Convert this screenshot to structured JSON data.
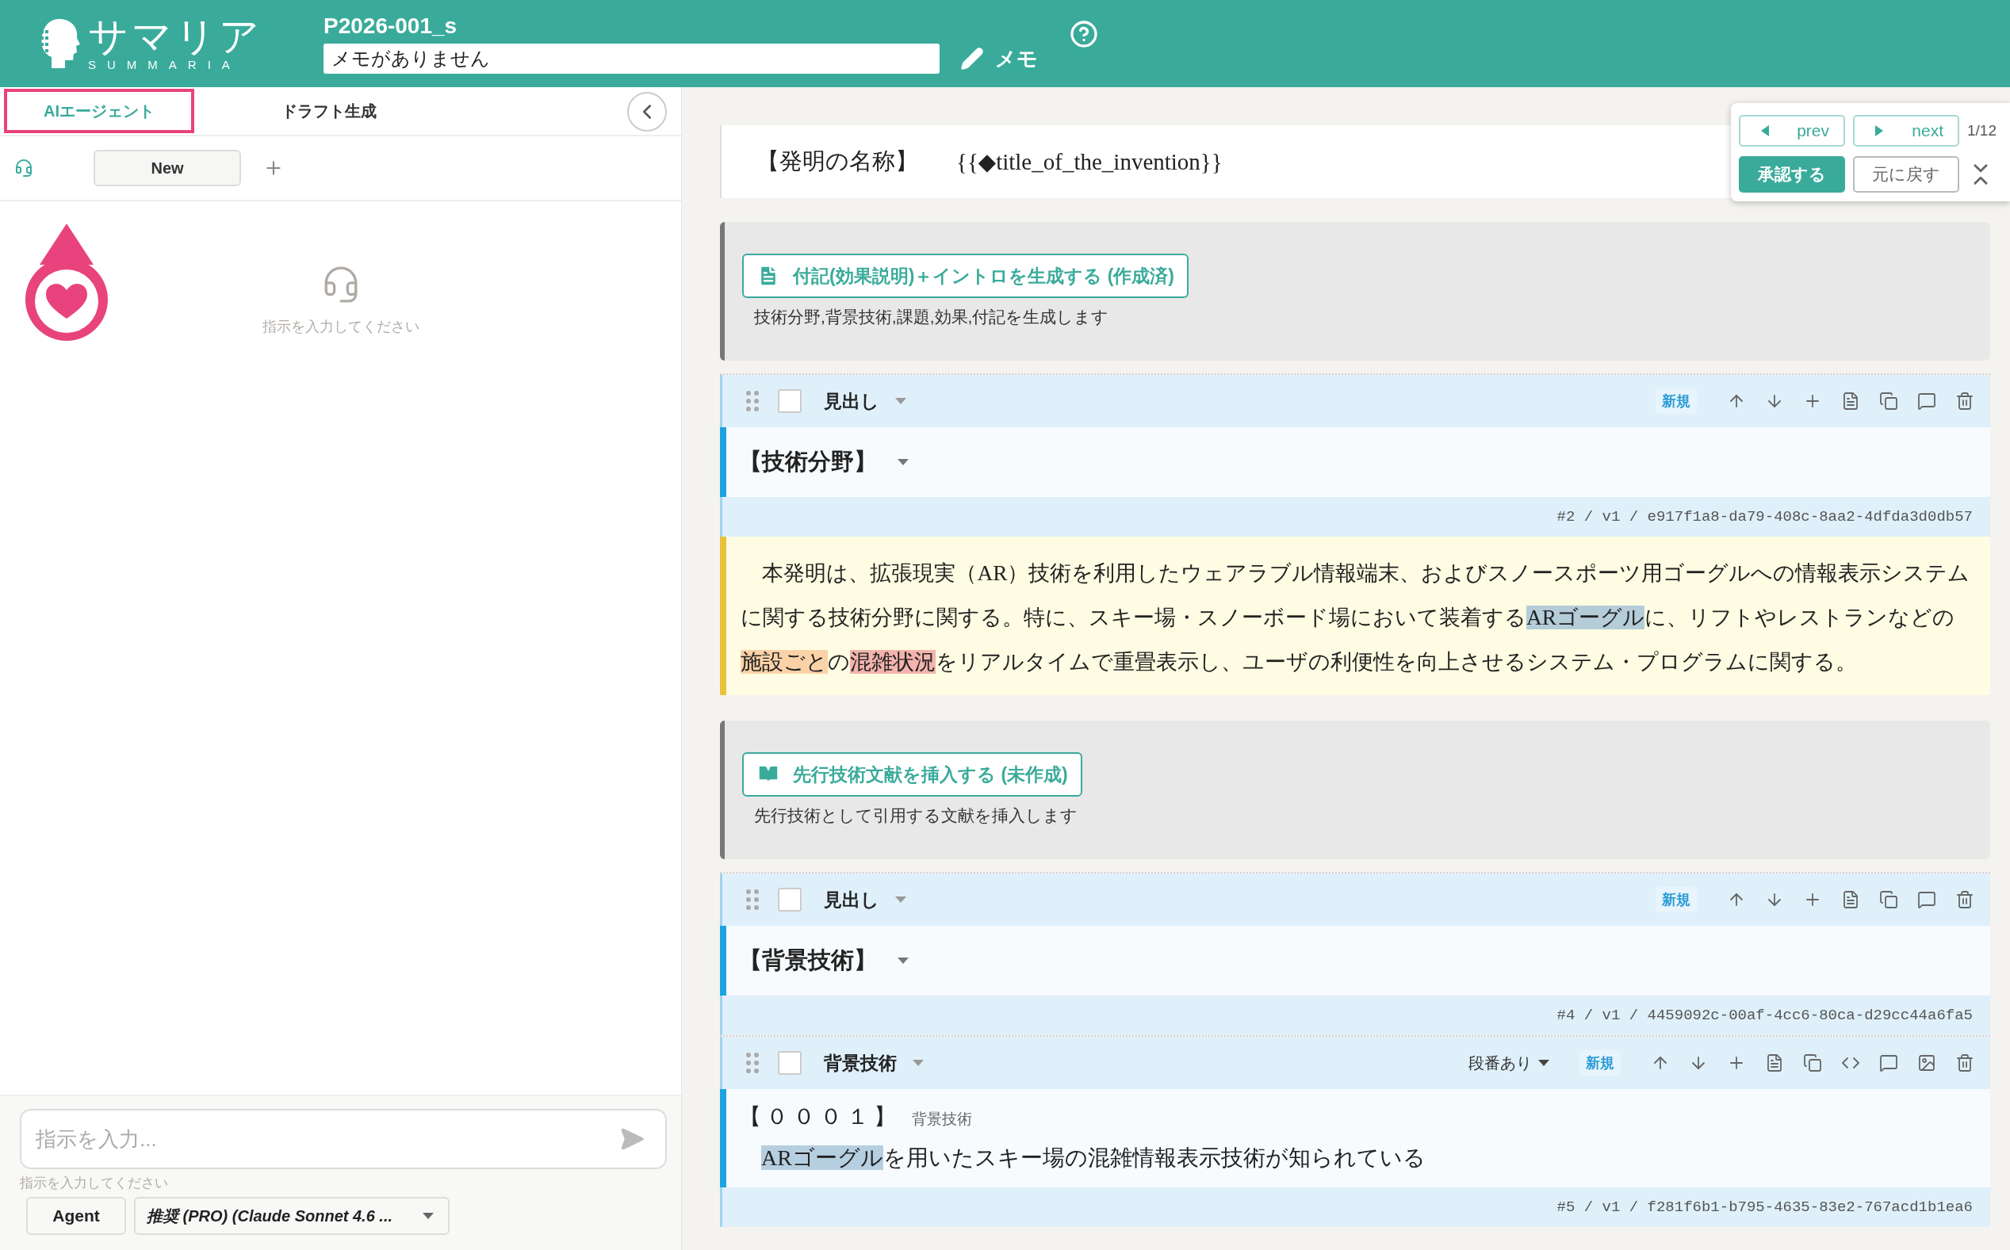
{
  "header": {
    "logo": {
      "kana": "サマリア",
      "latin": "SUMMARIA"
    },
    "project_title": "P2026-001_s",
    "memo": {
      "value": "メモがありません"
    },
    "memo_button": "メモ"
  },
  "left_panel": {
    "tabs": [
      {
        "label": "AIエージェント",
        "selected": true
      },
      {
        "label": "ドラフト生成",
        "selected": false
      }
    ],
    "sessions": [
      {
        "label": "New",
        "selected": true
      }
    ],
    "empty_state": "指示を入力してください",
    "input": {
      "placeholder": "指示を入力..."
    },
    "hint": "指示を入力してください",
    "mode_button": "Agent",
    "model_select": "推奨 (PRO) (Claude Sonnet 4.6 ..."
  },
  "nav": {
    "prev": "prev",
    "next": "next",
    "counter": "1/12",
    "approve": "承認する",
    "revert": "元に戻す"
  },
  "title_card": {
    "label": "【発明の名称】",
    "value": "{{◆title_of_the_invention}}"
  },
  "blocks": [
    {
      "kind": "action",
      "button": "付記(効果説明)＋イントロを生成する (作成済)",
      "description": "技術分野,背景技術,課題,効果,付記を生成します"
    },
    {
      "kind": "heading",
      "checked": false,
      "type_label": "見出し",
      "new_badge": "新規",
      "heading": "【技術分野】",
      "id": "#2 / v1 / e917f1a8-da79-408c-8aa2-4dfda3d0db57"
    },
    {
      "kind": "text",
      "segments": [
        {
          "text": "本発明は、拡張現実（AR）技術を利用したウェアラブル情報端末、およびスノースポーツ用ゴーグルへの情報表示システムに関する技術分野に関する。特に、スキー場・スノーボード場において装着する"
        },
        {
          "text": "ARゴーグル",
          "color": "#b4cdd9"
        },
        {
          "text": "に、リフトやレストランなどの"
        },
        {
          "text": "施設ごと",
          "color": "#fbd2a7"
        },
        {
          "text": "の"
        },
        {
          "text": "混雑状況",
          "color": "#f3b4ad"
        },
        {
          "text": "をリアルタイムで重畳表示し、ユーザの利便性を向上させるシステム・プログラムに関する。"
        }
      ]
    },
    {
      "kind": "action",
      "button": "先行技術文献を挿入する (未作成)",
      "description": "先行技術として引用する文献を挿入します"
    },
    {
      "kind": "heading",
      "checked": false,
      "type_label": "見出し",
      "new_badge": "新規",
      "heading": "【背景技術】",
      "id": "#4 / v1 / 4459092c-00af-4cc6-80ca-d29cc44a6fa5"
    },
    {
      "kind": "paragraph",
      "checked": false,
      "type_label": "背景技術",
      "numbering": "段番あり",
      "new_badge": "新規",
      "number": "【０００１】",
      "number_label": "背景技術",
      "segments": [
        {
          "text": "ARゴーグル",
          "color": "#b6cfe0"
        },
        {
          "text": "を用いたスキー場の混雑情報表示技術が知られている"
        }
      ],
      "id": "#5 / v1 / f281f6b1-b795-4635-83e2-767acd1b1ea6"
    }
  ]
}
